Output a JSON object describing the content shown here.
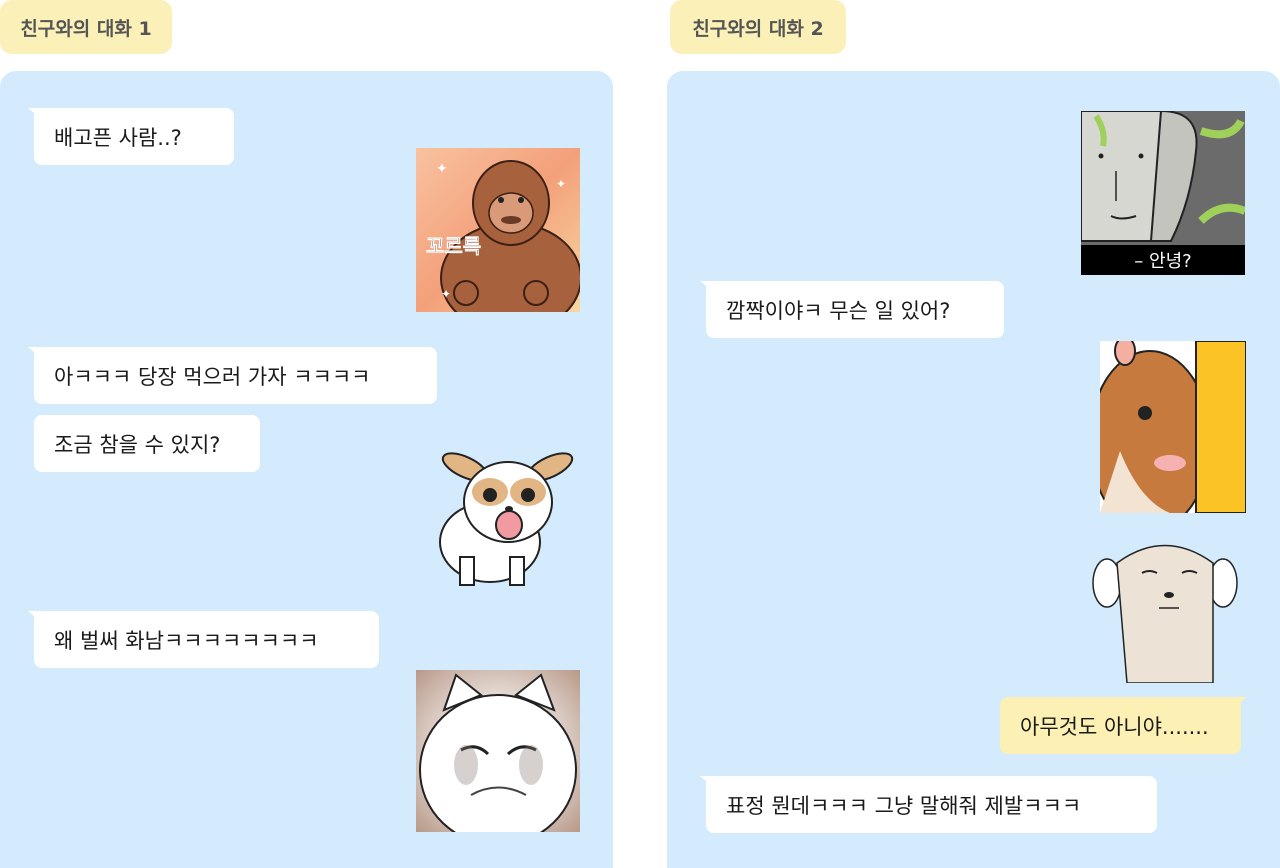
{
  "tabs": {
    "tab1": "친구와의 대화 1",
    "tab2": "친구와의 대화 2"
  },
  "panel1": {
    "messages": [
      "배고픈 사람..?",
      "아ㅋㅋㅋ 당장 먹으러 가자 ㅋㅋㅋㅋ",
      "조금 참을 수 있지?",
      "왜 벌써 화남ㅋㅋㅋㅋㅋㅋㅋㅋ"
    ],
    "stickers": {
      "gorilla_caption": "꼬르륵"
    }
  },
  "panel2": {
    "messages": [
      "깜짝이야ㅋ 무슨 일 있어?",
      "아무것도 아니야.......",
      "표정 뭔데ㅋㅋㅋ 그냥 말해줘 제발ㅋㅋㅋ"
    ],
    "stickers": {
      "face_caption": "– 안녕?"
    }
  },
  "colors": {
    "panel_bg": "#d4ebfd",
    "tab_bg": "#fbf0b8",
    "my_bubble": "#fdf0b5",
    "other_bubble": "#ffffff"
  }
}
